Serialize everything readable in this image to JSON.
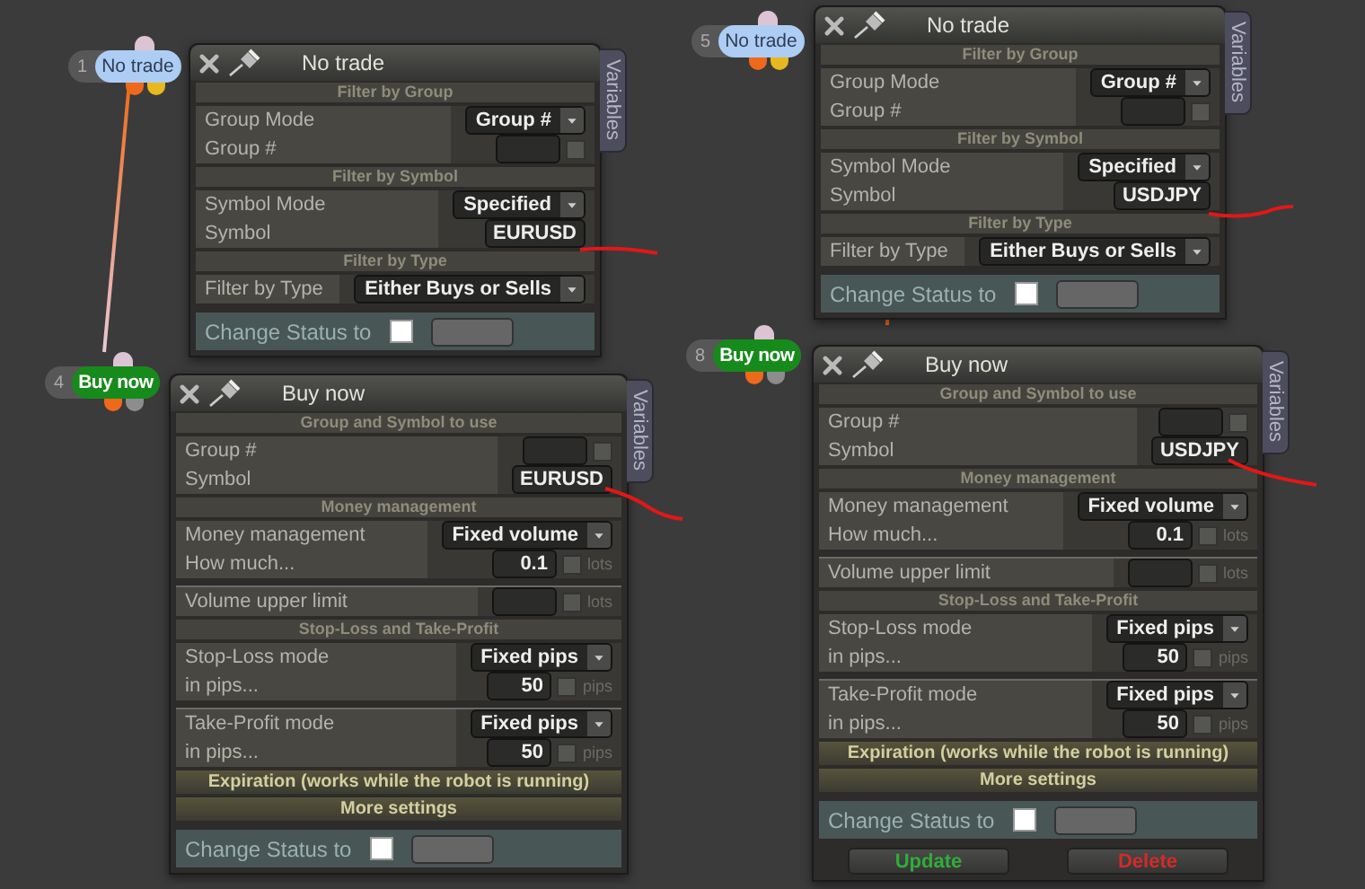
{
  "nodes": [
    {
      "number": "1",
      "label": "No trade",
      "kind": "condition",
      "color": "#aecdf4"
    },
    {
      "number": "4",
      "label": "Buy now",
      "kind": "action",
      "color": "#178a1c"
    },
    {
      "number": "5",
      "label": "No trade",
      "kind": "condition",
      "color": "#aecdf4"
    },
    {
      "number": "8",
      "label": "Buy now",
      "kind": "action",
      "color": "#178a1c"
    }
  ],
  "panels": [
    {
      "title": "No trade",
      "side_tab": "Variables",
      "sections": [
        {
          "heading": "Filter by Group",
          "kind": "open",
          "groups": [
            {
              "rows": [
                {
                  "label": "Group Mode",
                  "kind": "dropdown",
                  "value": "Group #"
                },
                {
                  "label": "Group #",
                  "kind": "input",
                  "checked": false
                }
              ]
            }
          ]
        },
        {
          "heading": "Filter by Symbol",
          "kind": "open",
          "groups": [
            {
              "rows": [
                {
                  "label": "Symbol Mode",
                  "kind": "dropdown",
                  "value": "Specified"
                },
                {
                  "label": "Symbol",
                  "kind": "input",
                  "value": "EURUSD"
                }
              ]
            }
          ]
        },
        {
          "heading": "Filter by Type",
          "kind": "open",
          "groups": [
            {
              "rows": [
                {
                  "label": "Filter by Type",
                  "kind": "dropdown",
                  "value": "Either Buys or Sells"
                }
              ]
            }
          ]
        }
      ],
      "status": {
        "label": "Change Status to",
        "checked": false
      }
    },
    {
      "title": "Buy now",
      "side_tab": "Variables",
      "sections": [
        {
          "heading": "Group and Symbol to use",
          "kind": "open",
          "groups": [
            {
              "rows": [
                {
                  "label": "Group #",
                  "kind": "input",
                  "checked": false
                },
                {
                  "label": "Symbol",
                  "kind": "input",
                  "value": "EURUSD"
                }
              ]
            }
          ]
        },
        {
          "heading": "Money management",
          "kind": "open",
          "groups": [
            {
              "rows": [
                {
                  "label": "Money management",
                  "kind": "dropdown",
                  "value": "Fixed volume"
                },
                {
                  "label": "How much...",
                  "kind": "input",
                  "value": "0.1",
                  "checked": false,
                  "unit": "lots"
                }
              ]
            },
            {
              "rows": [
                {
                  "label": "Volume upper limit",
                  "kind": "input",
                  "checked": false,
                  "unit": "lots"
                }
              ]
            }
          ]
        },
        {
          "heading": "Stop-Loss and Take-Profit",
          "kind": "open",
          "groups": [
            {
              "rows": [
                {
                  "label": "Stop-Loss mode",
                  "kind": "dropdown",
                  "value": "Fixed pips"
                },
                {
                  "label": "in pips...",
                  "kind": "input",
                  "value": "50",
                  "checked": false,
                  "unit": "pips"
                }
              ]
            },
            {
              "rows": [
                {
                  "label": "Take-Profit mode",
                  "kind": "dropdown",
                  "value": "Fixed pips"
                },
                {
                  "label": "in pips...",
                  "kind": "input",
                  "value": "50",
                  "checked": false,
                  "unit": "pips"
                }
              ]
            }
          ]
        },
        {
          "heading": "Expiration (works while the robot is running)",
          "kind": "collapsed"
        },
        {
          "heading": "More settings",
          "kind": "collapsed"
        }
      ],
      "status": {
        "label": "Change Status to",
        "checked": false
      }
    },
    {
      "title": "No trade",
      "side_tab": "Variables",
      "sections": [
        {
          "heading": "Filter by Group",
          "kind": "open",
          "groups": [
            {
              "rows": [
                {
                  "label": "Group Mode",
                  "kind": "dropdown",
                  "value": "Group #"
                },
                {
                  "label": "Group #",
                  "kind": "input",
                  "checked": false
                }
              ]
            }
          ]
        },
        {
          "heading": "Filter by Symbol",
          "kind": "open",
          "groups": [
            {
              "rows": [
                {
                  "label": "Symbol Mode",
                  "kind": "dropdown",
                  "value": "Specified"
                },
                {
                  "label": "Symbol",
                  "kind": "input",
                  "value": "USDJPY"
                }
              ]
            }
          ]
        },
        {
          "heading": "Filter by Type",
          "kind": "open",
          "groups": [
            {
              "rows": [
                {
                  "label": "Filter by Type",
                  "kind": "dropdown",
                  "value": "Either Buys or Sells"
                }
              ]
            }
          ]
        }
      ],
      "status": {
        "label": "Change Status to",
        "checked": false
      }
    },
    {
      "title": "Buy now",
      "side_tab": "Variables",
      "sections": [
        {
          "heading": "Group and Symbol to use",
          "kind": "open",
          "groups": [
            {
              "rows": [
                {
                  "label": "Group #",
                  "kind": "input",
                  "checked": false
                },
                {
                  "label": "Symbol",
                  "kind": "input",
                  "value": "USDJPY"
                }
              ]
            }
          ]
        },
        {
          "heading": "Money management",
          "kind": "open",
          "groups": [
            {
              "rows": [
                {
                  "label": "Money management",
                  "kind": "dropdown",
                  "value": "Fixed volume"
                },
                {
                  "label": "How much...",
                  "kind": "input",
                  "value": "0.1",
                  "checked": false,
                  "unit": "lots"
                }
              ]
            },
            {
              "rows": [
                {
                  "label": "Volume upper limit",
                  "kind": "input",
                  "checked": false,
                  "unit": "lots"
                }
              ]
            }
          ]
        },
        {
          "heading": "Stop-Loss and Take-Profit",
          "kind": "open",
          "groups": [
            {
              "rows": [
                {
                  "label": "Stop-Loss mode",
                  "kind": "dropdown",
                  "value": "Fixed pips"
                },
                {
                  "label": "in pips...",
                  "kind": "input",
                  "value": "50",
                  "checked": false,
                  "unit": "pips"
                }
              ]
            },
            {
              "rows": [
                {
                  "label": "Take-Profit mode",
                  "kind": "dropdown",
                  "value": "Fixed pips"
                },
                {
                  "label": "in pips...",
                  "kind": "input",
                  "value": "50",
                  "checked": false,
                  "unit": "pips"
                }
              ]
            }
          ]
        },
        {
          "heading": "Expiration (works while the robot is running)",
          "kind": "collapsed"
        },
        {
          "heading": "More settings",
          "kind": "collapsed"
        }
      ],
      "status": {
        "label": "Change Status to",
        "checked": false
      },
      "buttons": [
        {
          "label": "Update",
          "color": "#2fae3a"
        },
        {
          "label": "Delete",
          "color": "#d42a2a"
        }
      ]
    }
  ]
}
